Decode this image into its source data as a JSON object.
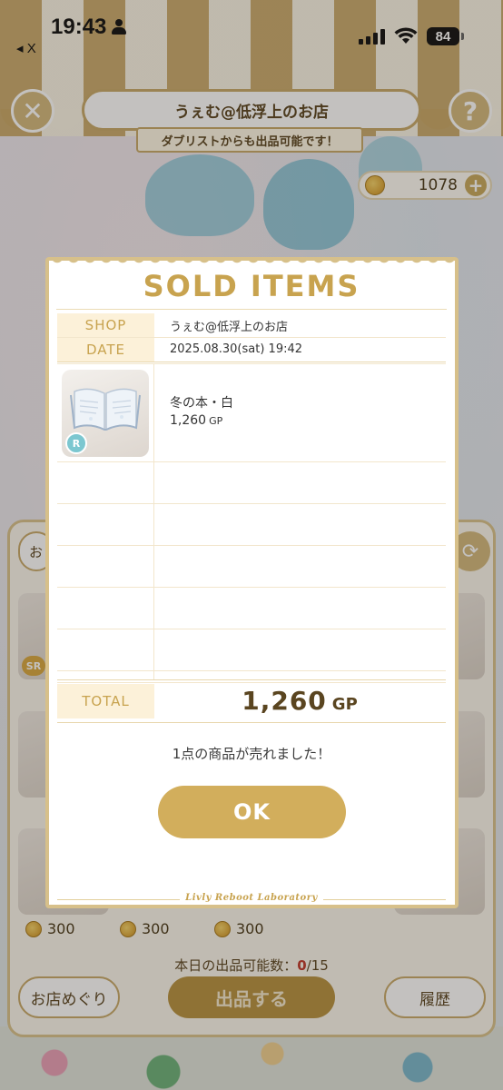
{
  "status_bar": {
    "time": "19:43",
    "back_app": "◂ X",
    "battery": "84"
  },
  "header": {
    "close_glyph": "✕",
    "help_glyph": "?",
    "shop_title": "うぇむ@低浮上のお店",
    "ribbon": "ダブリストからも出品可能です！",
    "gp_balance": "1078",
    "plus_glyph": "+"
  },
  "listing": {
    "left_button_partial": "お",
    "refresh_glyph": "⟳",
    "badge_sr": "SR",
    "prices": [
      "300",
      "300",
      "300"
    ],
    "daily_count_label": "本日の出品可能数：",
    "daily_count_value": "0",
    "daily_count_max": "/15",
    "tour_button": "お店めぐり",
    "list_button": "出品する",
    "history_button": "履歴"
  },
  "receipt": {
    "title": "SOLD ITEMS",
    "shop_label": "SHOP",
    "shop_value": "うぇむ@低浮上のお店",
    "date_label": "DATE",
    "date_value": "2025.08.30(sat) 19:42",
    "items": [
      {
        "name": "冬の本・白",
        "price": "1,260",
        "unit": "GP",
        "rarity": "R",
        "icon": "open-book-icon"
      }
    ],
    "total_label": "TOTAL",
    "total_value": "1,260",
    "total_unit": "GP",
    "message": "1点の商品が売れました！",
    "ok_button": "OK",
    "brand": "Livly Reboot Laboratory"
  },
  "colors": {
    "gold": "#c8a34f",
    "gold_button": "#d2ae5c",
    "label_bg": "#fcf1d9",
    "accent_red": "#c0392b"
  }
}
